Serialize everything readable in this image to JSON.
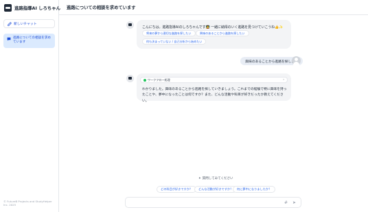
{
  "app": {
    "title": "進路指導AI しろちゃん"
  },
  "sidebar": {
    "new_chat_label": "新しいチャット",
    "conversations": [
      {
        "label": "進路についての相談を求めています"
      }
    ],
    "footer_line1": "© FutureB Projects and StudyHelper",
    "footer_line2": "Inc. 2025"
  },
  "header": {
    "title": "進路についての相談を求めています"
  },
  "messages": {
    "greeting": "こんにちは。進路指導AIのしろちゃんです🧑‍🏫 一緒に納得のいく進路を見つけていこうね👍✨",
    "chips": [
      "将来の夢から適切な進路を探したい",
      "興味のあることから進路を探したい",
      "何も決まっていない / 自己分析から始めたい"
    ],
    "user_text": "興味のあることから進路を探したい",
    "workflow_label": "ワークフロー処理",
    "reply": "わかりました。興味のあることから進路を探していきましょう。これまでの経験で特に興味を持ったことや、夢中になったことは何ですか？また、どんな活動や科目が好きだったか教えてください。"
  },
  "suggestions": {
    "title": "質問してみてください",
    "items": [
      "どの科目が好きですか？",
      "どんな活動が好きですか？",
      "何に夢中になりましたか？"
    ]
  },
  "input": {
    "placeholder": ""
  },
  "icons": {
    "new_chat": "edit-icon",
    "conversation": "chat-bubble-icon",
    "workflow": "check-circle-icon",
    "suggestion": "sparkle-icon",
    "attach": "hash-icon",
    "send": "send-icon"
  },
  "colors": {
    "accent": "#2563eb",
    "selected_bg": "#dbeafe",
    "bubble_bg": "#f3f4f6"
  }
}
